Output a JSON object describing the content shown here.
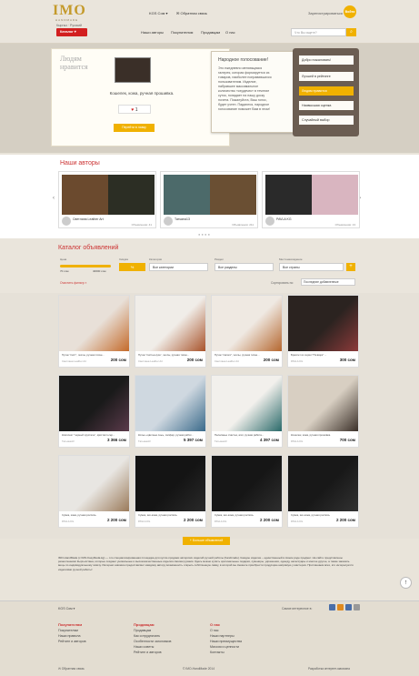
{
  "header": {
    "logo": "IMO",
    "logo_sub": "HANDMADE",
    "currency": "KGS Сом ▾",
    "feedback": "Обратная связь",
    "register": "Зарегистрироваться",
    "login": "Войти",
    "languages": "Кыргыз · Русский",
    "catalog_btn": "Каталог ▾",
    "nav": [
      "Наши авторы",
      "Покупателям",
      "Продавцам",
      "О нас"
    ],
    "search_placeholder": "Что Вы ищете?"
  },
  "hero": {
    "people_like": "Людям нравится",
    "caption": "Кошелек, кожа, ручная прошивка.",
    "likes": "1",
    "goto_shop": "Перейти в лавку",
    "vote_title": "Народное голосование!",
    "vote_text": "Это ежедневно меняющаяся галерея, которая формируется из товаров, наиболее понравившихся пользователям. Изделие, набравшее максимальное количество «сердечек» в течение суток, попадает на нашу доску почета. Пожалуйста, Ваш голос, будет учтен. Падаются, народное голосование поможет Вам в этом!",
    "board": [
      "Добро пожаловать!",
      "Лучшей в рейтинге",
      "Людям нравится",
      "Наивысшая оценка",
      "Случайный выбор"
    ]
  },
  "authors": {
    "heading": "Наши авторы",
    "cards": [
      {
        "name": "Светлана Leather Art",
        "count": "Объявления: 41"
      },
      {
        "name": "Татьяна13",
        "count": "Объявления: 211"
      },
      {
        "name": "PAVLA KG",
        "count": "Объявления: 13"
      }
    ],
    "dots": "● ● ● ●"
  },
  "catalog": {
    "heading": "Каталог объявлений",
    "labels": [
      "Цена",
      "Скидка",
      "Категория",
      "Раздел",
      "Местонахождение"
    ],
    "price_min": "70 сом",
    "price_max": "40000 сом",
    "discount": "%",
    "category": "Все категории",
    "section": "Все разделы",
    "location": "Все страны",
    "plus": "+",
    "clear": "Очистить фильтр ×",
    "sort_label": "Сортировать по:",
    "sort": "Последние добавленные"
  },
  "items": [
    {
      "title": "Пучок \"лист\", чехлы, ручная тисне...",
      "author": "Светлана Leather Art",
      "price": "200 сом"
    },
    {
      "title": "Пучок \"листья-кусь\", чехлы, ручная тисне...",
      "author": "Светлана Leather Art",
      "price": "200 сом"
    },
    {
      "title": "Пучок \"сапоги\", чехлы, ручная тисне...",
      "author": "Светлана Leather Art",
      "price": "200 сом"
    },
    {
      "title": "Браслет из серии \"Пэчворк\" ...",
      "author": "PAVLA KG",
      "price": "300 сом"
    },
    {
      "title": "Комплект \"черный хрусталь\", кристалл-сер...",
      "author": "Татьяна13",
      "price": "3 366 сом"
    },
    {
      "title": "Колье «цветные сны», салфер, ручная работ...",
      "author": "Татьяна13",
      "price": "5 397 сом"
    },
    {
      "title": "Пелесанье счастья, агат, ручная работа...",
      "author": "Татьяна13",
      "price": "4 397 сом"
    },
    {
      "title": "Кошелек, кожа, ручная прошивка.",
      "author": "PAVLA KG",
      "price": "700 сом"
    },
    {
      "title": "Сумка, кожа, ручная роспись",
      "author": "PAVLA KG",
      "price": "2 200 сом"
    },
    {
      "title": "Сумка, эко-кожа, ручная роспись",
      "author": "PAVLA KG",
      "price": "2 200 сом"
    },
    {
      "title": "Сумка, эко-кожа, ручная роспись",
      "author": "PAVLA KG",
      "price": "2 200 сом"
    },
    {
      "title": "Сумка, эко-кожа, ручная роспись",
      "author": "PAVLA KG",
      "price": "2 200 сом"
    }
  ],
  "more_btn": "+ Больше объявлений",
  "about": "IMO-HandMade (с IMO-KasyMeda.kg) — это специализированная площадка для купли-продажи авторских изделий ручной работы (handmade). Каждое изделие – единственный в своем роде предмет. На сайте представлены ремесленники Кыргызстана, которые создают уникальные и высококачественные изделия своими руками. Здесь можно купить оригинальные подарки, сувениры, украшения, одежду, аксессуары и многое другое, а также заказать вещь по индивидуальному эскизу. Интернет-магазин предоставляет каждому автору возможность открыть собственную лавку, в которой вы сможете приобрести продукцию напрямую у мастеров. Приглашаем всех, кто интересуется изделиями ручной работы!",
  "footer": {
    "currency": "KGS Сом ▾",
    "social_label": "Самое интересное в:",
    "cols": [
      {
        "title": "Покупателям",
        "links": [
          "Покупателям",
          "Наши правила",
          "Рейтинг и авторов"
        ]
      },
      {
        "title": "Продавцам",
        "links": [
          "Продавцам",
          "Как сотрудничать",
          "Особенности заголовков",
          "Наши советы",
          "Рейтинг и авторов"
        ]
      },
      {
        "title": "О нас",
        "links": [
          "О нас",
          "Наши партнеры",
          "Наши преимущества",
          "Миссия и ценности",
          "Контакты"
        ]
      }
    ],
    "feedback": "Обратная связь",
    "copyright": "© IMO-HandMade 2014",
    "dev": "Разработка интернет-магазина"
  }
}
